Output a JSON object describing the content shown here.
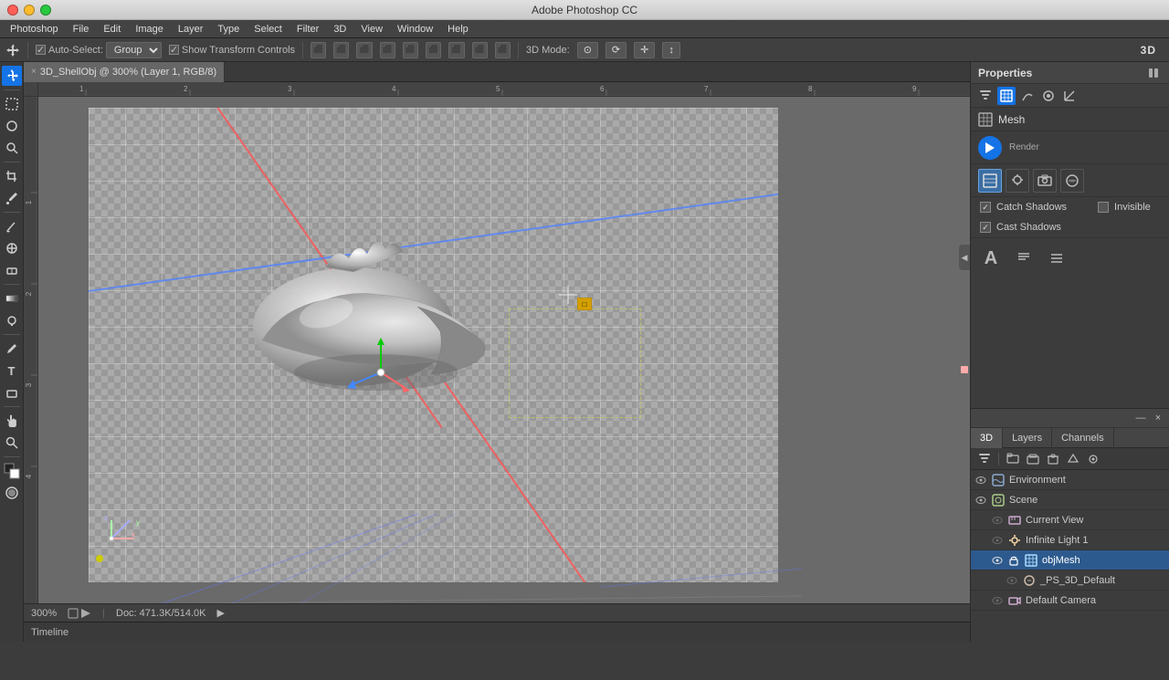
{
  "titlebar": {
    "title": "Adobe Photoshop CC"
  },
  "menubar": {
    "items": [
      "Photoshop",
      "File",
      "Edit",
      "Image",
      "Layer",
      "Type",
      "Select",
      "Filter",
      "3D",
      "View",
      "Window",
      "Help"
    ]
  },
  "optionsbar": {
    "autoselectLabel": "Auto-Select:",
    "autoselectValue": "Group",
    "showTransformLabel": "Show Transform Controls",
    "alignButtons": [
      "↖",
      "↑",
      "↗",
      "←",
      "↔",
      "→",
      "↙",
      "↓",
      "↘"
    ],
    "threedModeLabel": "3D Mode:",
    "threedValue": "3D",
    "modeButtons": [
      "⊙",
      "✛",
      "⟳",
      "↕"
    ]
  },
  "tabbar": {
    "closeBtn": "×",
    "docName": "3D_ShellObj @ 300% (Layer 1, RGB/8)"
  },
  "canvas": {
    "zoomLevel": "300%",
    "docInfo": "Doc: 471.3K/514.0K"
  },
  "statusbar": {
    "zoom": "300%",
    "docInfo": "Doc: 471.3K/514.0K",
    "timelineLabel": "Timeline"
  },
  "properties": {
    "title": "Properties",
    "meshLabel": "Mesh",
    "catchShadows": "Catch Shadows",
    "castShadows": "Cast Shadows",
    "invisibleLabel": "Invisible",
    "catchChecked": true,
    "castChecked": true,
    "invisibleChecked": false
  },
  "layers3d": {
    "tabs": [
      "3D",
      "Layers",
      "Channels"
    ],
    "activeTab": "3D",
    "items": [
      {
        "id": "environment",
        "indent": 0,
        "hasArrow": false,
        "eye": true,
        "iconType": "env",
        "name": "Environment"
      },
      {
        "id": "scene",
        "indent": 0,
        "hasArrow": false,
        "eye": true,
        "iconType": "scene",
        "name": "Scene"
      },
      {
        "id": "currentview",
        "indent": 1,
        "hasArrow": false,
        "eye": false,
        "iconType": "camera",
        "name": "Current View"
      },
      {
        "id": "infinitelight",
        "indent": 1,
        "hasArrow": false,
        "eye": false,
        "iconType": "light",
        "name": "Infinite Light 1"
      },
      {
        "id": "objmesh",
        "indent": 1,
        "hasArrow": true,
        "eye": true,
        "iconType": "mesh",
        "name": "objMesh",
        "selected": true
      },
      {
        "id": "ps3ddefault",
        "indent": 2,
        "hasArrow": false,
        "eye": false,
        "iconType": "material",
        "name": "_PS_3D_Default"
      },
      {
        "id": "defaultcamera",
        "indent": 1,
        "hasArrow": false,
        "eye": false,
        "iconType": "camera2",
        "name": "Default Camera"
      }
    ]
  },
  "icons": {
    "eye": "👁",
    "arrow_right": "▶",
    "arrow_down": "▼",
    "close": "×",
    "move": "✛",
    "marquee": "▭",
    "lasso": "⌒",
    "crop": "⊡",
    "eyedropper": "⌇",
    "brush": "✏",
    "clone": "⊕",
    "eraser": "◻",
    "dodge": "○",
    "pen": "✒",
    "type": "T",
    "shape": "◈",
    "hand": "✋",
    "zoom": "⊕",
    "fg_bg": "◧",
    "mask": "◎"
  }
}
